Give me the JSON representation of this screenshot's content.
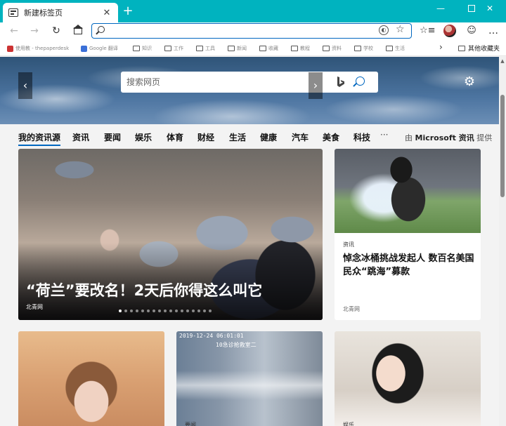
{
  "tab": {
    "title": "新建标签页",
    "close": "✕",
    "new": "+"
  },
  "window": {
    "minimize": "—",
    "close": "✕"
  },
  "toolbar": {
    "back": "←",
    "forward": "→",
    "refresh": "↻",
    "address_value": "",
    "address_placeholder": "",
    "tracking": "◐",
    "favorite": "☆",
    "favorites": "☆≡",
    "feedback": "☺",
    "more": "…"
  },
  "favorites": {
    "items": [
      "使用教 - thepaperdesk",
      "Google 翻译",
      "知识",
      "工作",
      "工具",
      "新闻",
      "收藏",
      "教程",
      "资料",
      "学校",
      "生活"
    ],
    "overflow": "›",
    "other": "其他收藏夹"
  },
  "search": {
    "placeholder": "搜索网页"
  },
  "settings_icon": "⚙",
  "categories": {
    "items": [
      "我的资讯源",
      "资讯",
      "要闻",
      "娱乐",
      "体育",
      "财经",
      "生活",
      "健康",
      "汽车",
      "美食",
      "科技"
    ],
    "more": "···",
    "provider_prefix": "由",
    "provider_name": "Microsoft 资讯",
    "provider_suffix": "提供"
  },
  "hero": {
    "title": "“荷兰”要改名！2天后你得这么叫它",
    "source": "北青网",
    "prev": "‹",
    "next": "›",
    "slide_count": 17,
    "current_slide": 1
  },
  "side_article": {
    "tag": "资讯",
    "title": "悼念冰桶挑战发起人 数百名美国民众“跳海”募款",
    "source": "北青网"
  },
  "bottom_cards": [
    {
      "tag": ""
    },
    {
      "tag": "要闻",
      "timestamp": "2019-12-24 06:01:01",
      "caption": "10急诊抢救室二"
    },
    {
      "tag": "娱乐"
    }
  ]
}
